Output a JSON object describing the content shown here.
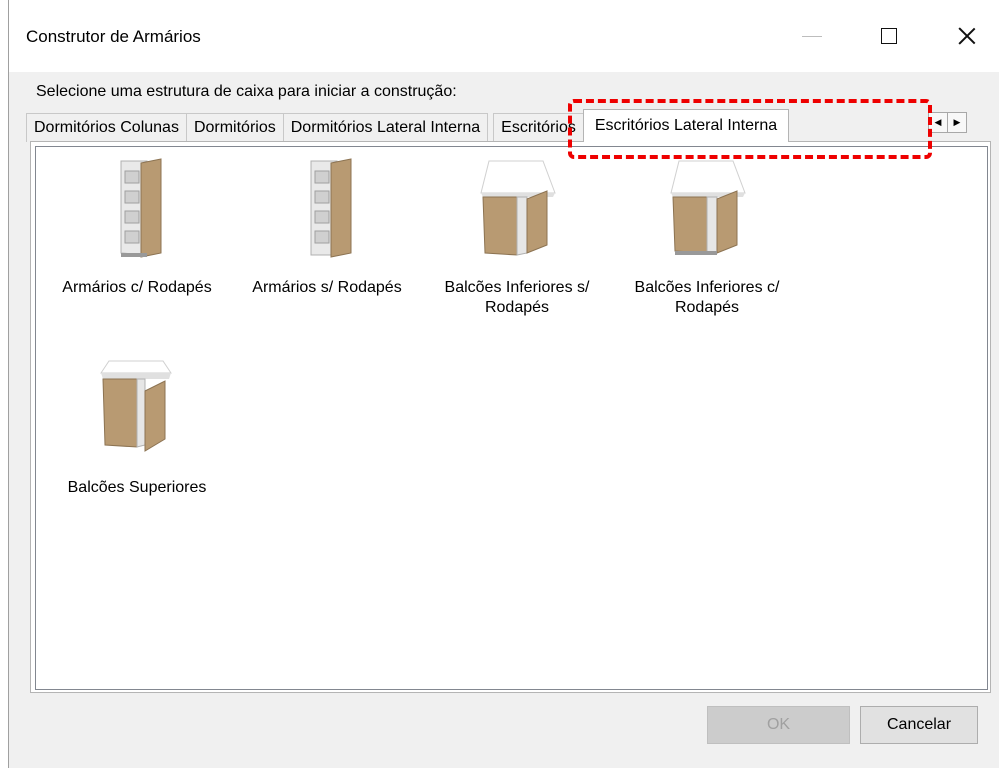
{
  "window": {
    "title": "Construtor de Armários"
  },
  "prompt": "Selecione uma estrutura de caixa para iniciar a construção:",
  "tabs": [
    {
      "label": "Dormitórios Colunas"
    },
    {
      "label": "Dormitórios"
    },
    {
      "label": "Dormitórios Lateral Interna"
    },
    {
      "label": "Escritórios"
    },
    {
      "label": "Escritórios Lateral Interna"
    }
  ],
  "active_tab": "Escritórios Lateral Interna",
  "items": [
    {
      "label": "Armários c/ Rodapés",
      "icon": "tall-cabinet-icon"
    },
    {
      "label": "Armários s/ Rodapés",
      "icon": "tall-cabinet-icon"
    },
    {
      "label": "Balcões Inferiores s/ Rodapés",
      "icon": "base-cabinet-icon"
    },
    {
      "label": "Balcões Inferiores c/ Rodapés",
      "icon": "base-cabinet-icon"
    },
    {
      "label": "Balcões Superiores",
      "icon": "upper-cabinet-icon"
    }
  ],
  "buttons": {
    "ok": "OK",
    "cancel": "Cancelar"
  },
  "colors": {
    "highlight": "#ee0000",
    "wood": "#b89a72"
  }
}
